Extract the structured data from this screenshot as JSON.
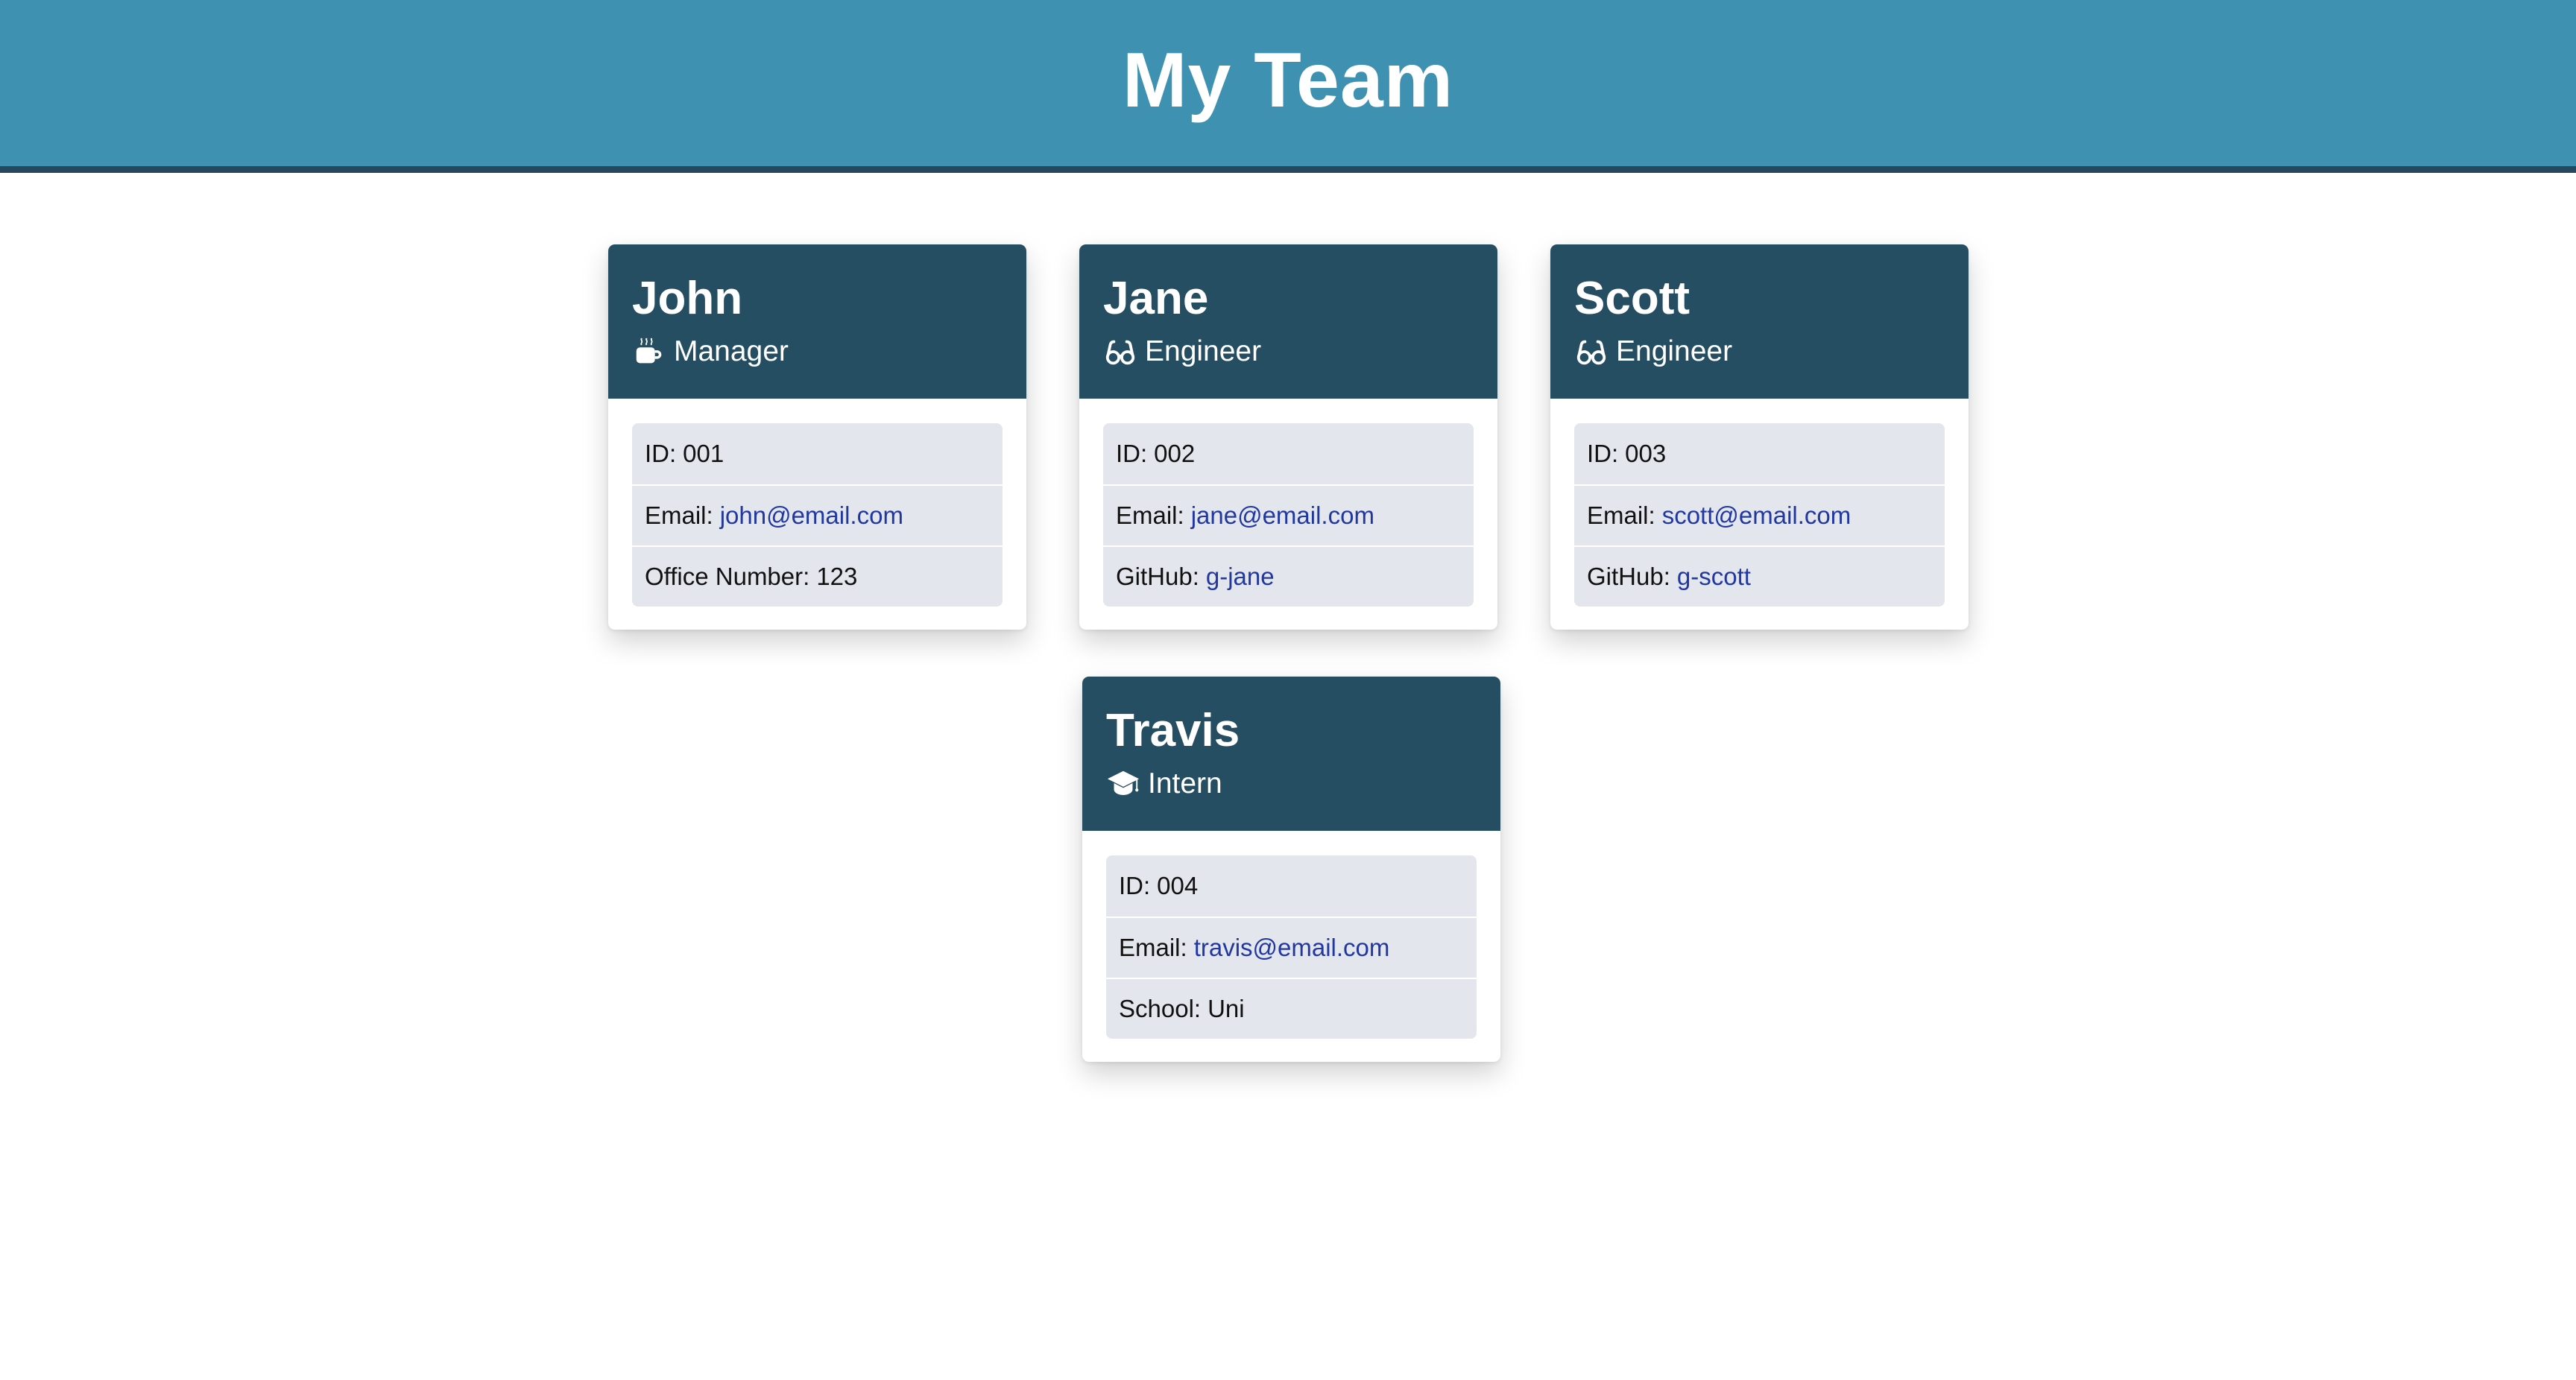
{
  "banner": {
    "title": "My Team"
  },
  "colors": {
    "banner": "#3f91b1",
    "banner_border": "#25485f",
    "card_header": "#264e63",
    "list_bg": "#e3e6ec",
    "link": "#2238a1"
  },
  "cards": [
    {
      "name": "John",
      "role": "Manager",
      "role_icon": "coffee-mug-icon",
      "id_label": "ID:",
      "id": "001",
      "email_label": "Email:",
      "email": "john@email.com",
      "extra_label": "Office Number:",
      "extra": "123"
    },
    {
      "name": "Jane",
      "role": "Engineer",
      "role_icon": "glasses-icon",
      "id_label": "ID:",
      "id": "002",
      "email_label": "Email:",
      "email": "jane@email.com",
      "extra_label": "GitHub:",
      "extra": "g-jane"
    },
    {
      "name": "Scott",
      "role": "Engineer",
      "role_icon": "glasses-icon",
      "id_label": "ID:",
      "id": "003",
      "email_label": "Email:",
      "email": "scott@email.com",
      "extra_label": "GitHub:",
      "extra": "g-scott"
    },
    {
      "name": "Travis",
      "role": "Intern",
      "role_icon": "graduation-cap-icon",
      "id_label": "ID:",
      "id": "004",
      "email_label": "Email:",
      "email": "travis@email.com",
      "extra_label": "School:",
      "extra": "Uni"
    }
  ]
}
